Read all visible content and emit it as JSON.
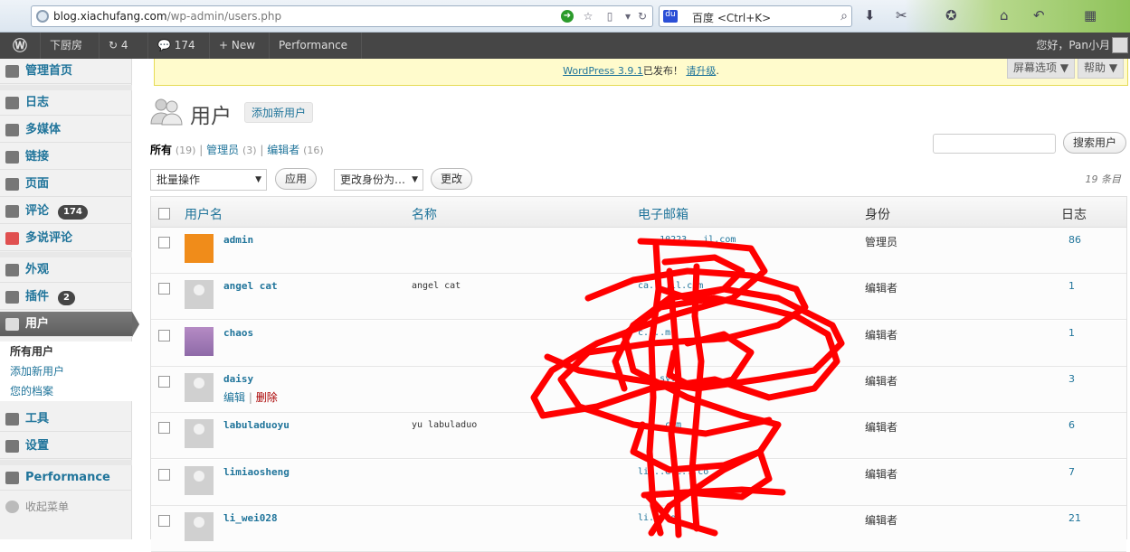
{
  "browser": {
    "url_domain": "blog.xiachufang.com",
    "url_path": "/wp-admin/users.php",
    "search_engine": "百度",
    "search_placeholder": "百度 <Ctrl+K>"
  },
  "adminbar": {
    "site": "下厨房",
    "updates": "4",
    "comments": "174",
    "new": "New",
    "performance": "Performance",
    "greeting": "您好，Pan小月"
  },
  "sidebar": {
    "dashboard": "管理首页",
    "posts": "日志",
    "media": "多媒体",
    "links": "链接",
    "pages": "页面",
    "comments": "评论",
    "comments_count": "174",
    "duoshuo": "多说评论",
    "appearance": "外观",
    "plugins": "插件",
    "plugins_count": "2",
    "users": "用户",
    "sub_all": "所有用户",
    "sub_add": "添加新用户",
    "sub_profile": "您的档案",
    "tools": "工具",
    "settings": "设置",
    "performance": "Performance",
    "collapse": "收起菜单"
  },
  "notice": {
    "link": "WordPress 3.9.1",
    "text": "已发布！",
    "upgrade": "请升级",
    "dot": "."
  },
  "help": {
    "screen_options": "屏幕选项 ▼",
    "help": "帮助 ▼"
  },
  "page": {
    "title": "用户",
    "add_new": "添加新用户",
    "filter_all": "所有",
    "filter_all_count": "(19)",
    "filter_admin": "管理员",
    "filter_admin_count": "(3)",
    "filter_editor": "编辑者",
    "filter_editor_count": "(16)",
    "search_button": "搜索用户",
    "bulk": "批量操作",
    "apply": "应用",
    "change_role": "更改身份为…",
    "change": "更改",
    "count": "19 条目"
  },
  "table": {
    "headers": {
      "username": "用户名",
      "name": "名称",
      "email": "电子邮箱",
      "role": "身份",
      "posts": "日志"
    },
    "rows": [
      {
        "username": "admin",
        "name": "",
        "email": "....10223...il.com",
        "role": "管理员",
        "posts": "86",
        "avatar": "orange"
      },
      {
        "username": "angel cat",
        "name": "angel cat",
        "email": "ca....ll.com",
        "role": "编辑者",
        "posts": "1",
        "avatar": "grey"
      },
      {
        "username": "chaos",
        "name": "",
        "email": "c....m",
        "role": "编辑者",
        "posts": "1",
        "avatar": "anime"
      },
      {
        "username": "daisy",
        "name": "",
        "email": "....sy...",
        "role": "编辑者",
        "posts": "3",
        "avatar": "grey",
        "edit": "编辑",
        "delete": "删除"
      },
      {
        "username": "labuladuoyu",
        "name": "yu labuladuo",
        "email": "x....com",
        "role": "编辑者",
        "posts": "6",
        "avatar": "grey"
      },
      {
        "username": "limiaosheng",
        "name": "",
        "email": "li...ele...co",
        "role": "编辑者",
        "posts": "7",
        "avatar": "grey"
      },
      {
        "username": "li_wei028",
        "name": "",
        "email": "li...com",
        "role": "编辑者",
        "posts": "21",
        "avatar": "grey"
      }
    ]
  },
  "colors": {
    "link": "#21759b",
    "adminbar": "#464646",
    "scribble": "#ff0000",
    "notice_bg": "#fffbcc"
  }
}
